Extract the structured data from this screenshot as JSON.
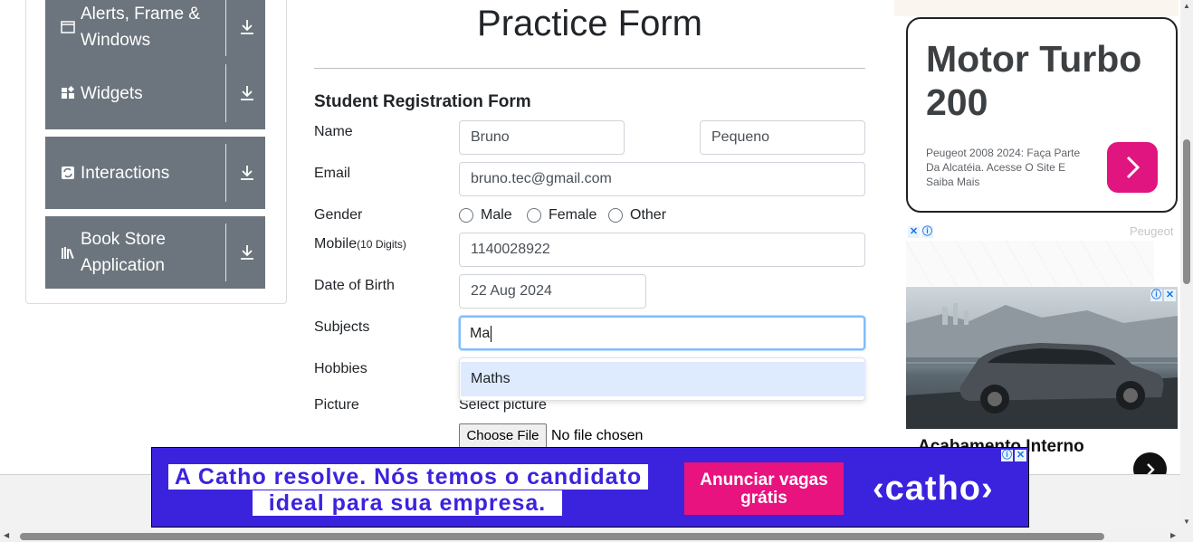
{
  "sidebar": {
    "items": [
      {
        "label": "Alerts, Frame & Windows",
        "icon": "window-icon"
      },
      {
        "label": "Widgets",
        "icon": "widgets-icon"
      },
      {
        "label": "Interactions",
        "icon": "interactions-icon"
      },
      {
        "label": "Book Store Application",
        "icon": "books-icon"
      }
    ]
  },
  "form": {
    "page_title": "Practice Form",
    "subtitle": "Student Registration Form",
    "name_label": "Name",
    "first_name": "Bruno",
    "last_name": "Pequeno",
    "email_label": "Email",
    "email": "bruno.tec@gmail.com",
    "gender_label": "Gender",
    "gender_options": [
      "Male",
      "Female",
      "Other"
    ],
    "mobile_label": "Mobile",
    "mobile_hint": "(10 Digits)",
    "mobile": "1140028922",
    "dob_label": "Date of Birth",
    "dob": "22 Aug 2024",
    "subjects_label": "Subjects",
    "subjects_value": "Ma",
    "subjects_suggestion": "Maths",
    "hobbies_label": "Hobbies",
    "picture_label": "Picture",
    "select_picture": "Select picture",
    "choose_file": "Choose File",
    "no_file": "No file chosen"
  },
  "ads": {
    "ad1_headline": "Motor Turbo 200",
    "ad1_desc": "Peugeot 2008 2024: Faça Parte Da Alcatéia. Acesse O Site E Saiba Mais",
    "sponsor": "Peugeot",
    "ad2_text": "Acabamento Interno",
    "banner_line1": "A Catho resolve. Nós temos o candidato",
    "banner_line2": "ideal para sua empresa.",
    "banner_cta": "Anunciar vagas grátis",
    "banner_brand": "‹catho›"
  },
  "colors": {
    "nav_bg": "#6c757d",
    "focus_border": "#80bdff",
    "suggestion_bg": "#deebff",
    "ad_pink": "#e0157f",
    "banner_blue": "#3b23de"
  }
}
